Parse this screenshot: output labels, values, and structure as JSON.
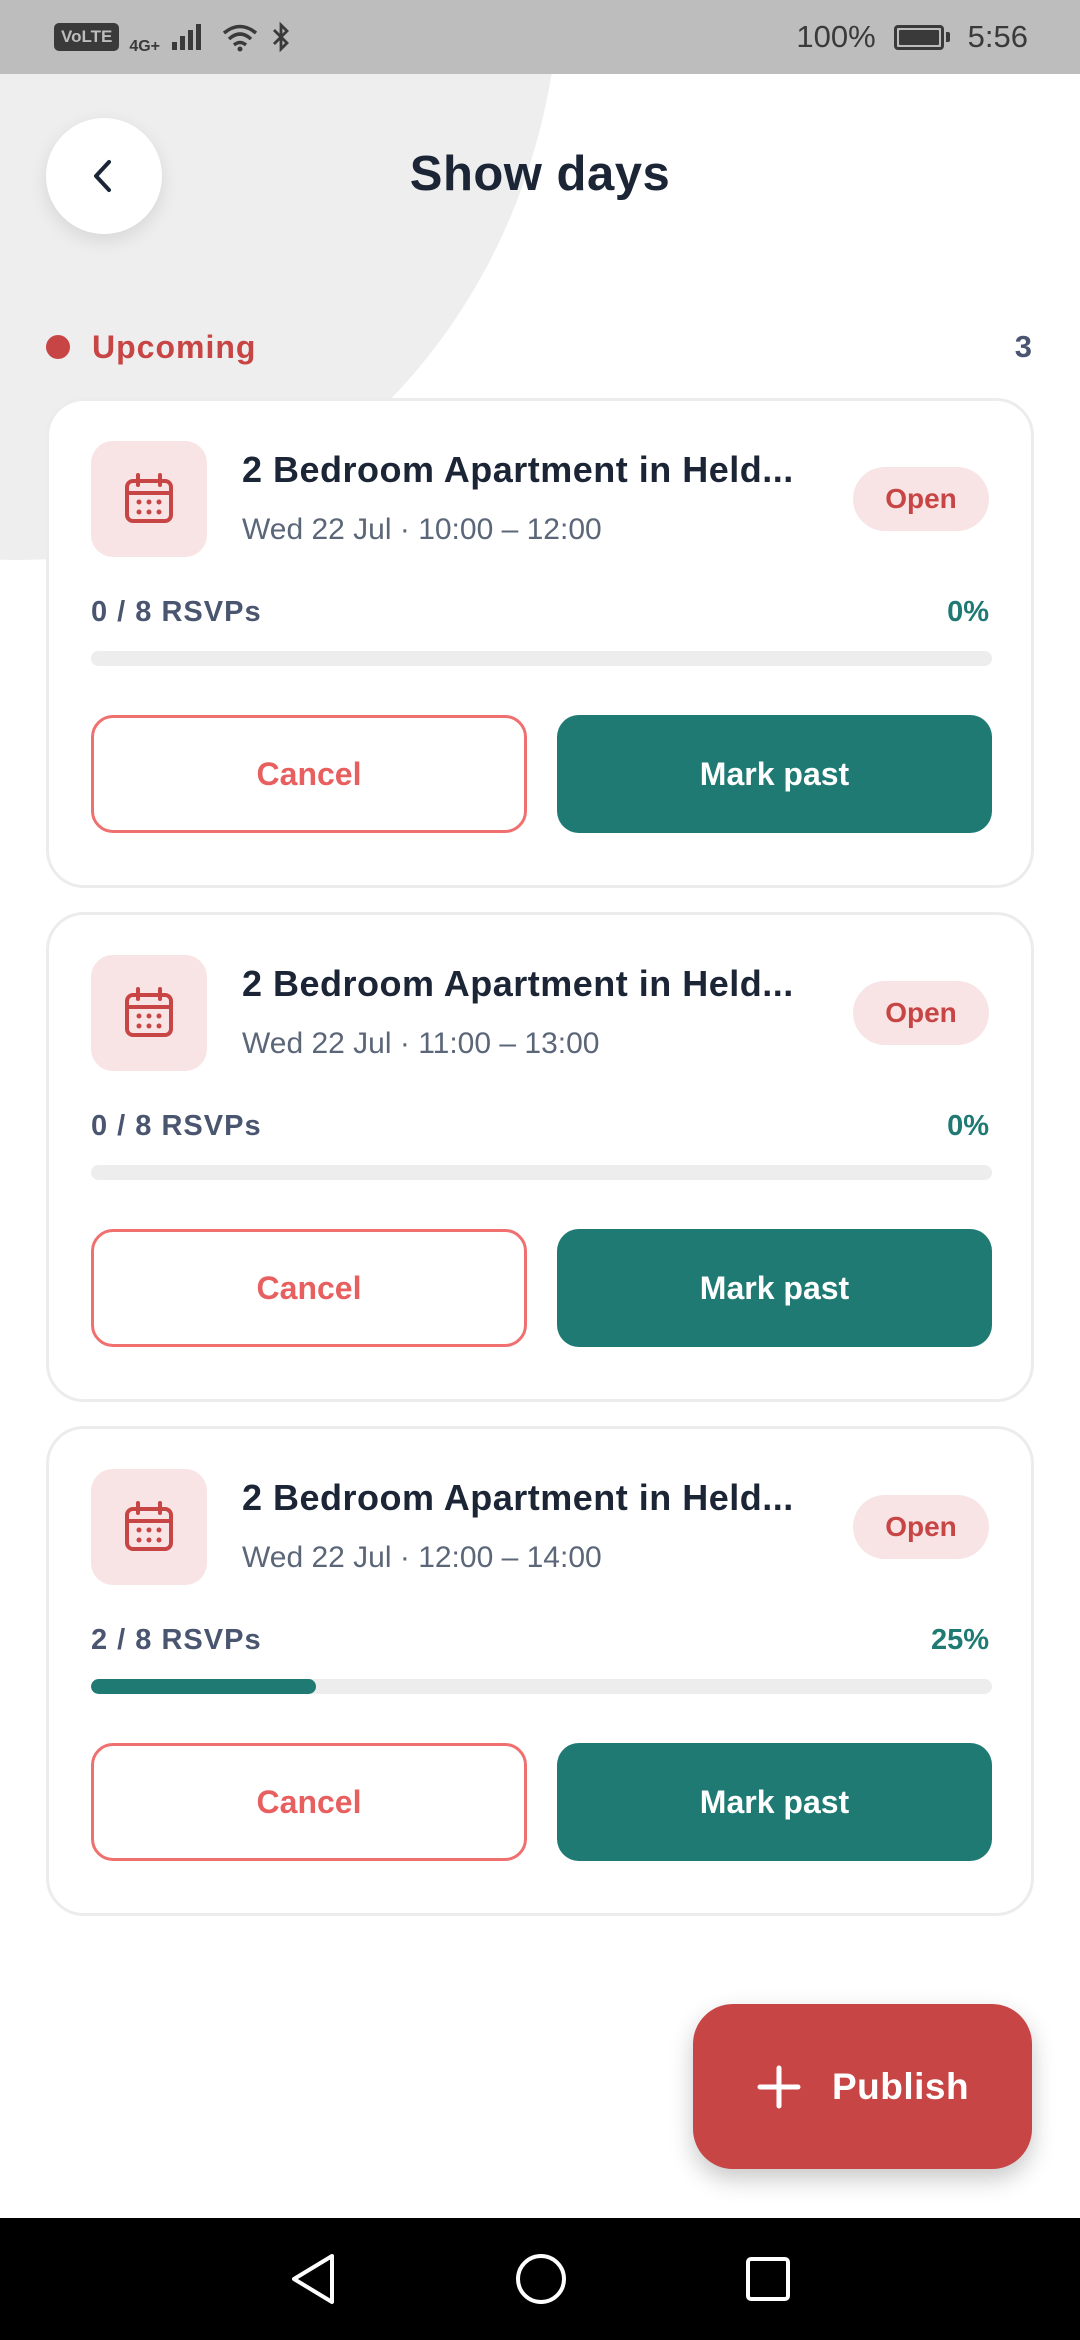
{
  "status_bar": {
    "volte": "VoLTE",
    "network": "4G+",
    "battery": "100%",
    "time": "5:56"
  },
  "header": {
    "title": "Show days",
    "back_icon": "chevron-left-icon"
  },
  "section": {
    "label": "Upcoming",
    "count": "3",
    "dot_color": "#c84545"
  },
  "cards": [
    {
      "title": "2 Bedroom Apartment in Held...",
      "time": "Wed 22 Jul · 10:00 – 12:00",
      "status": "Open",
      "rsvps": "0 / 8 RSVPs",
      "percent_label": "0%",
      "progress": 0,
      "cancel_label": "Cancel",
      "mark_past_label": "Mark past"
    },
    {
      "title": "2 Bedroom Apartment in Held...",
      "time": "Wed 22 Jul · 11:00 – 13:00",
      "status": "Open",
      "rsvps": "0 / 8 RSVPs",
      "percent_label": "0%",
      "progress": 0,
      "cancel_label": "Cancel",
      "mark_past_label": "Mark past"
    },
    {
      "title": "2 Bedroom Apartment in Held...",
      "time": "Wed 22 Jul · 12:00 – 14:00",
      "status": "Open",
      "rsvps": "2 / 8 RSVPs",
      "percent_label": "25%",
      "progress": 0.25,
      "cancel_label": "Cancel",
      "mark_past_label": "Mark past"
    }
  ],
  "fab": {
    "label": "Publish",
    "icon": "plus-icon"
  },
  "colors": {
    "accent_red": "#c84545",
    "accent_teal": "#1f7a73",
    "badge_bg": "#f8e4e4"
  }
}
